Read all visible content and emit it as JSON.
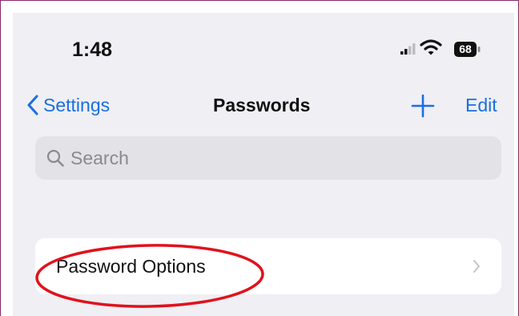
{
  "status_bar": {
    "time": "1:48",
    "battery_level": "68",
    "icons": [
      "signal-icon",
      "wifi-icon",
      "battery-icon"
    ]
  },
  "nav": {
    "back_label": "Settings",
    "title": "Passwords",
    "edit_label": "Edit",
    "icons": [
      "chevron-left-icon",
      "plus-icon"
    ]
  },
  "search": {
    "placeholder": "Search",
    "value": "",
    "icon": "search-icon"
  },
  "list": {
    "items": [
      {
        "label": "Password Options",
        "icon": "chevron-right-icon"
      }
    ]
  },
  "colors": {
    "accent": "#1a6fe0",
    "background": "#efeff4",
    "annotation": "#e0121c"
  }
}
